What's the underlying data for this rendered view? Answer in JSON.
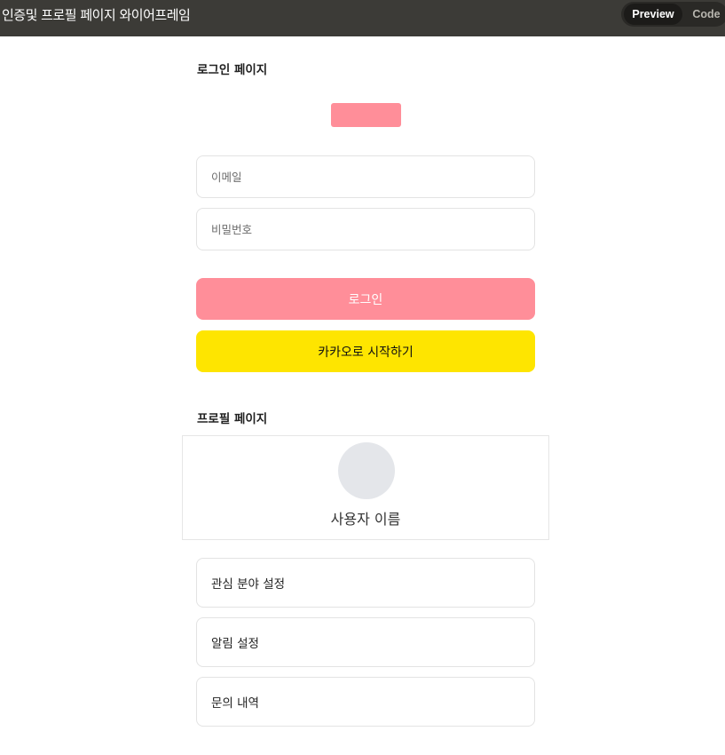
{
  "window": {
    "title": "인증및 프로필 페이지 와이어프레임",
    "view_toggle": {
      "preview_label": "Preview",
      "code_label": "Code",
      "selected": "Preview"
    }
  },
  "login_page": {
    "section_title": "로그인 페이지",
    "logo_color": "#ff8e99",
    "email_placeholder": "이메일",
    "password_placeholder": "비밀번호",
    "login_button": "로그인",
    "kakao_button": "카카오로 시작하기",
    "colors": {
      "login_button": "#ff8e99",
      "kakao_button": "#fee500"
    }
  },
  "profile_page": {
    "section_title": "프로필 페이지",
    "username": "사용자 이름",
    "menu_items": [
      {
        "label": "관심 분야 설정"
      },
      {
        "label": "알림 설정"
      },
      {
        "label": "문의 내역"
      }
    ]
  }
}
